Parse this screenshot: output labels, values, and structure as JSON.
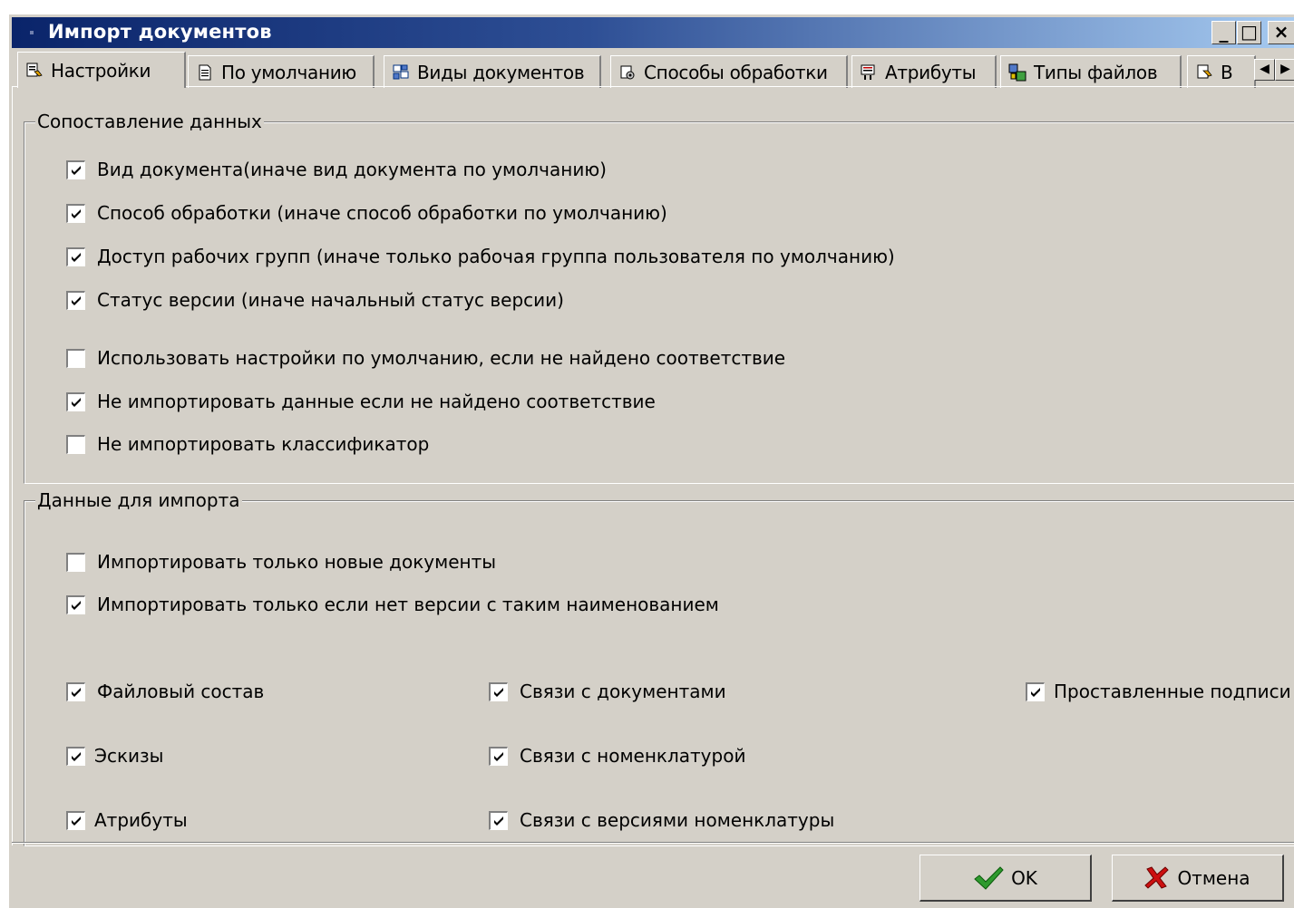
{
  "window": {
    "title": "Импорт документов",
    "controls": {
      "minimize": "_",
      "maximize": "□",
      "close": "×"
    }
  },
  "tabs": [
    {
      "label": "Настройки",
      "icon": "settings-icon",
      "active": true
    },
    {
      "label": "По умолчанию",
      "icon": "document-icon",
      "active": false
    },
    {
      "label": "Виды документов",
      "icon": "doc-types-icon",
      "active": false
    },
    {
      "label": "Способы обработки",
      "icon": "processing-icon",
      "active": false
    },
    {
      "label": "Атрибуты",
      "icon": "attributes-icon",
      "active": false
    },
    {
      "label": "Типы файлов",
      "icon": "file-types-icon",
      "active": false
    },
    {
      "label": "В",
      "icon": "truncated-tab-icon",
      "active": false
    }
  ],
  "tab_scroll": {
    "left": "◀",
    "right": "▶"
  },
  "mapping_group": {
    "title": "Сопоставление данных",
    "items": [
      {
        "label": "Вид документа(иначе вид документа по умолчанию)",
        "checked": true
      },
      {
        "label": "Способ обработки (иначе способ обработки по умолчанию)",
        "checked": true
      },
      {
        "label": "Доступ рабочих групп (иначе только рабочая группа пользователя по умолчанию)",
        "checked": true
      },
      {
        "label": "Статус версии (иначе начальный статус версии)",
        "checked": true
      },
      {
        "label": "Использовать настройки по умолчанию, если не найдено соответствие",
        "checked": false
      },
      {
        "label": "Не импортировать данные если не найдено соответствие",
        "checked": true
      },
      {
        "label": "Не импортировать классификатор",
        "checked": false
      }
    ]
  },
  "import_group": {
    "title": "Данные для импорта",
    "items": [
      {
        "label": "Импортировать только новые документы",
        "checked": false
      },
      {
        "label": "Импортировать только если нет версии с таким наименованием",
        "checked": true
      }
    ],
    "grid": [
      {
        "label": "Файловый состав",
        "checked": true
      },
      {
        "label": "Связи с документами",
        "checked": true
      },
      {
        "label": "Проставленные подписи",
        "checked": true
      },
      {
        "label": "Эскизы",
        "checked": true
      },
      {
        "label": "Связи с номенклатурой",
        "checked": true
      },
      {
        "label": "Атрибуты",
        "checked": true
      },
      {
        "label": "Связи с версиями номенклатуры",
        "checked": true
      }
    ]
  },
  "buttons": {
    "ok": "OK",
    "cancel": "Отмена"
  },
  "colors": {
    "face": "#d4d0c8",
    "title_start": "#0a246a",
    "title_end": "#a6caf0",
    "ok_check": "#2e9a2e",
    "cancel_x": "#cc1010"
  }
}
